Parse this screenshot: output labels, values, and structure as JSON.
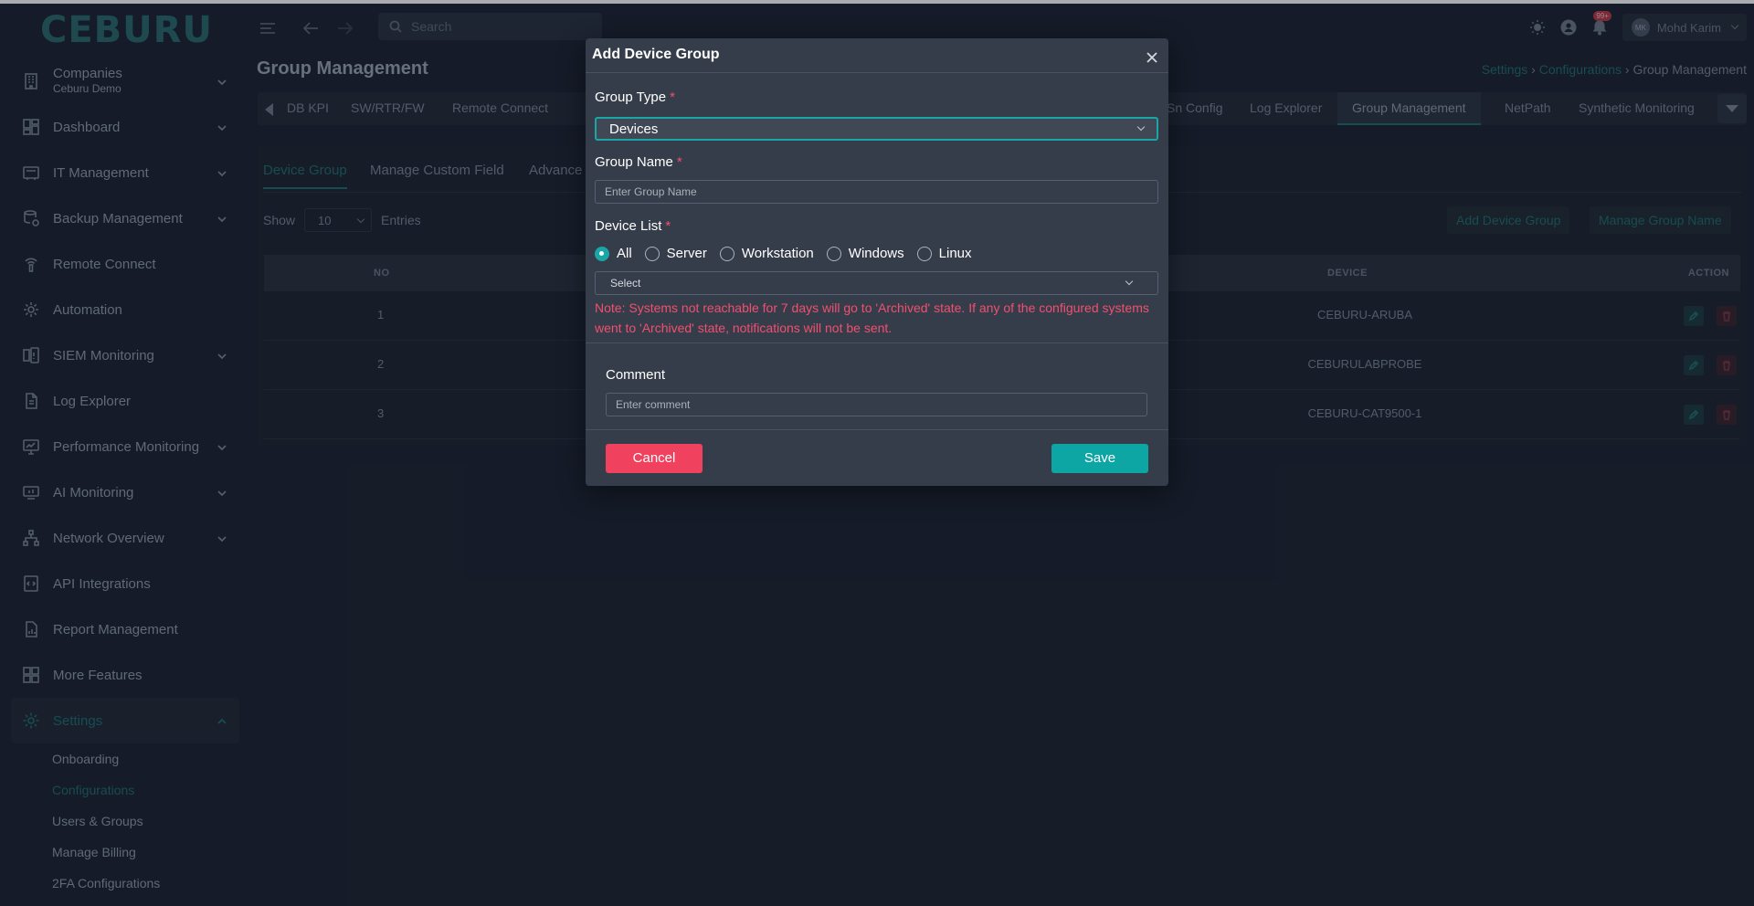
{
  "brand": {
    "logo_text": "CEBURU"
  },
  "topbar": {
    "search_placeholder": "Search",
    "notifications_badge": "99+",
    "user_initials": "MK",
    "user_name": "Mohd Karim"
  },
  "sidebar": {
    "company": {
      "label": "Companies",
      "sub": "Ceburu Demo"
    },
    "items": [
      {
        "label": "Dashboard",
        "icon": "dashboard-icon",
        "expandable": true
      },
      {
        "label": "IT Management",
        "icon": "it-management-icon",
        "expandable": true
      },
      {
        "label": "Backup Management",
        "icon": "backup-icon",
        "expandable": true
      },
      {
        "label": "Remote Connect",
        "icon": "remote-connect-icon",
        "expandable": false
      },
      {
        "label": "Automation",
        "icon": "automation-gear-icon",
        "expandable": false
      },
      {
        "label": "SIEM Monitoring",
        "icon": "siem-icon",
        "expandable": true
      },
      {
        "label": "Log Explorer",
        "icon": "document-icon",
        "expandable": false
      },
      {
        "label": "Performance Monitoring",
        "icon": "monitor-icon",
        "expandable": true
      },
      {
        "label": "AI Monitoring",
        "icon": "ai-monitor-icon",
        "expandable": true
      },
      {
        "label": "Network Overview",
        "icon": "network-icon",
        "expandable": true
      },
      {
        "label": "API Integrations",
        "icon": "code-icon",
        "expandable": false
      },
      {
        "label": "Report Management",
        "icon": "report-icon",
        "expandable": false
      },
      {
        "label": "More Features",
        "icon": "grid-icon",
        "expandable": false
      },
      {
        "label": "Settings",
        "icon": "settings-gear-icon",
        "expandable": true,
        "active": true
      }
    ],
    "settings_sub": [
      "Onboarding",
      "Configurations",
      "Users & Groups",
      "Manage Billing",
      "2FA Configurations"
    ],
    "settings_sub_active": "Configurations"
  },
  "page": {
    "title": "Group Management",
    "breadcrumb": [
      "Settings",
      "Configurations",
      "Group Management"
    ]
  },
  "tabs": [
    "DB KPI",
    "SW/RTR/FW",
    "Remote Connect",
    "Sn Config",
    "Log Explorer",
    "Group Management",
    "NetPath",
    "Synthetic Monitoring"
  ],
  "tabs_active": "Group Management",
  "subtabs": [
    "Device Group",
    "Manage Custom Field",
    "Advance"
  ],
  "subtabs_active": "Device Group",
  "list": {
    "show_label": "Show",
    "entries_value": "10",
    "entries_label": "Entries",
    "add_button": "Add Device Group",
    "manage_button": "Manage Group Name",
    "columns": {
      "no": "NO",
      "device": "DEVICE",
      "action": "ACTION"
    },
    "rows": [
      {
        "no": "1",
        "device": "CEBURU-ARUBA"
      },
      {
        "no": "2",
        "device": "CEBURULABPROBE"
      },
      {
        "no": "3",
        "device": "CEBURU-CAT9500-1"
      }
    ]
  },
  "modal": {
    "title": "Add Device Group",
    "group_type_label": "Group Type",
    "group_type_value": "Devices",
    "group_name_label": "Group Name",
    "group_name_placeholder": "Enter Group Name",
    "device_list_label": "Device List",
    "required_mark": "*",
    "radio_options": [
      "All",
      "Server",
      "Workstation",
      "Windows",
      "Linux"
    ],
    "radio_selected": "All",
    "device_select_placeholder": "Select",
    "note": "Note: Systems not reachable for 7 days will go to 'Archived' state. If any of the configured systems went to 'Archived' state, notifications will not be sent.",
    "comment_label": "Comment",
    "comment_placeholder": "Enter comment",
    "cancel": "Cancel",
    "save": "Save"
  },
  "colors": {
    "accent": "#0ea5a5",
    "danger": "#f0415e",
    "note_text": "#f0506e",
    "modal_bg": "#363d4a",
    "page_bg": "#1c2332"
  }
}
